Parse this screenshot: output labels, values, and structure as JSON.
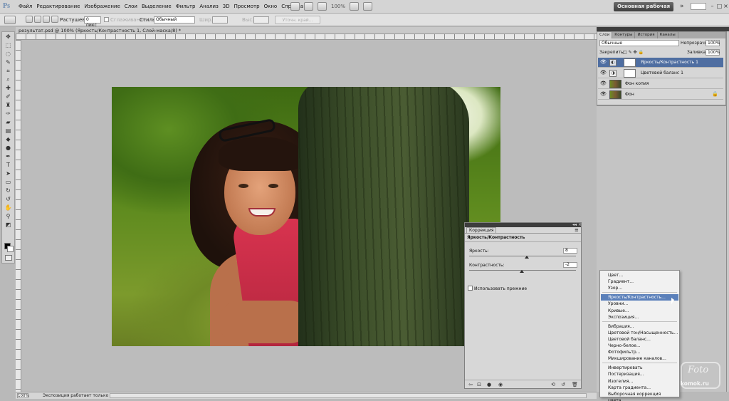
{
  "app": {
    "logo": "Ps",
    "menu": [
      "Файл",
      "Редактирование",
      "Изображение",
      "Слои",
      "Выделение",
      "Фильтр",
      "Анализ",
      "3D",
      "Просмотр",
      "Окно",
      "Справка"
    ],
    "zoom": "100%",
    "workspace": "Основная рабочая среда",
    "overflow": "»"
  },
  "options": {
    "feather_label": "Растушевка:",
    "feather_value": "0 пикс",
    "antialias_label": "Сглаживание",
    "style_label": "Стиль:",
    "style_value": "Обычный",
    "width_label": "Шир.:",
    "height_label": "Выс.:",
    "refine_label": "Уточн. край..."
  },
  "document": {
    "tab_title": "результат.psd @ 100% (Яркость/Контрастность 1, Слой-маска/8) *",
    "status_zoom": "100%",
    "status_info": "Экспозиция работает только в ..."
  },
  "layers": {
    "tabs": [
      "Слои",
      "Контуры",
      "История",
      "Каналы"
    ],
    "blend_mode": "Обычные",
    "opacity_label": "Непрозрачность:",
    "opacity_value": "100%",
    "lock_label": "Закрепить:",
    "fill_label": "Заливка:",
    "fill_value": "100%",
    "items": [
      {
        "name": "Яркость/Контрастность 1",
        "active": true
      },
      {
        "name": "Цветовой баланс 1",
        "active": false
      },
      {
        "name": "Фон копия",
        "active": false
      },
      {
        "name": "Фон",
        "active": false
      }
    ]
  },
  "adjustments": {
    "tab": "Коррекция",
    "title": "Яркость/Контрастность",
    "brightness_label": "Яркость:",
    "brightness_value": "8",
    "contrast_label": "Контрастность:",
    "contrast_value": "-2",
    "legacy_label": "Использовать прежние",
    "brightness_level": 0.54,
    "contrast_level": 0.49
  },
  "context_menu": {
    "groups": [
      [
        "Цвет...",
        "Градиент...",
        "Узор..."
      ],
      [
        "Яркость/Контрастность...",
        "Уровни...",
        "Кривые...",
        "Экспозиция..."
      ],
      [
        "Вибрация...",
        "Цветовой тон/Насыщенность...",
        "Цветовой баланс...",
        "Черно-белое...",
        "Фотофильтр...",
        "Микширование каналов..."
      ],
      [
        "Инвертировать",
        "Постеризация...",
        "Изогелия...",
        "Карта градиента...",
        "Выборочная коррекция цвета..."
      ]
    ],
    "highlighted": "Яркость/Контрастность..."
  },
  "watermark": {
    "line1": "Foto",
    "line2": "komok.ru"
  }
}
